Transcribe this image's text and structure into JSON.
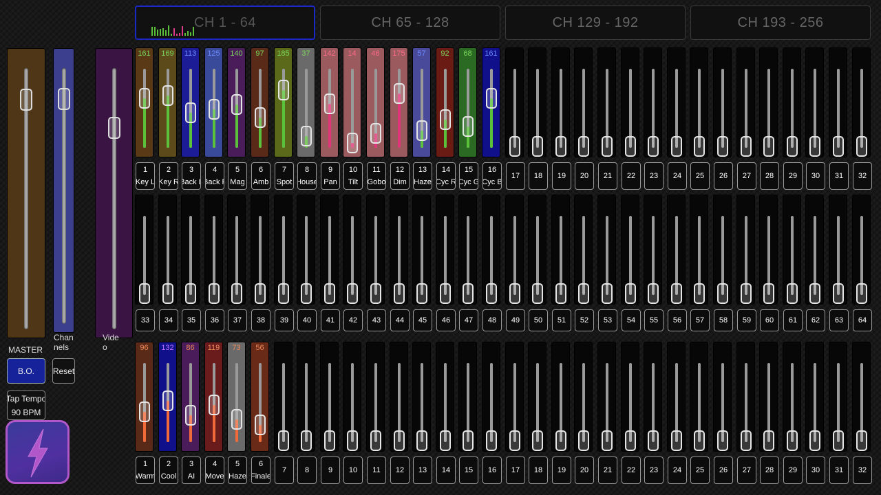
{
  "tabs": [
    {
      "label": "CH 1 - 64",
      "active": true
    },
    {
      "label": "CH 65 - 128",
      "active": false
    },
    {
      "label": "CH 129 - 192",
      "active": false
    },
    {
      "label": "CH 193 - 256",
      "active": false
    }
  ],
  "masters": {
    "master_label": "MASTER",
    "channels_label": "Chan\nnels",
    "video_label": "Vide\no",
    "bo_button": "B.O.",
    "reset_button": "Reset",
    "tap_tempo": "Tap Tempo",
    "bpm": "90 BPM",
    "master_level": 0.88,
    "channels_level": 0.88,
    "video_level": 0.77
  },
  "row1_channels": [
    {
      "num": "1",
      "name": "Key L",
      "value": "161",
      "color": "#5a3a16",
      "fill": "#5bc03a",
      "level": 0.63
    },
    {
      "num": "2",
      "name": "Key R",
      "value": "169",
      "color": "#5c4a1a",
      "fill": "#5bc03a",
      "level": 0.66
    },
    {
      "num": "3",
      "name": "Back L",
      "value": "113",
      "color": "#1c1c96",
      "fill": "#5bc03a",
      "level": 0.44
    },
    {
      "num": "4",
      "name": "Back R",
      "value": "125",
      "color": "#3a4a9a",
      "fill": "#5bc03a",
      "level": 0.49
    },
    {
      "num": "5",
      "name": "Mag",
      "value": "140",
      "color": "#4a1c5a",
      "fill": "#5bc03a",
      "level": 0.55
    },
    {
      "num": "6",
      "name": "Amb",
      "value": "97",
      "color": "#5a2a18",
      "fill": "#5bc03a",
      "level": 0.38
    },
    {
      "num": "7",
      "name": "Spot",
      "value": "185",
      "color": "#5a6a1a",
      "fill": "#5bc03a",
      "level": 0.73
    },
    {
      "num": "8",
      "name": "House",
      "value": "37",
      "color": "#6a6a6a",
      "fill": "#5bc03a",
      "level": 0.15
    },
    {
      "num": "9",
      "name": "Pan",
      "value": "142",
      "color": "#9a5a5e",
      "fill": "#e0357a",
      "level": 0.56
    },
    {
      "num": "10",
      "name": "Tilt",
      "value": "14",
      "color": "#9a5a5e",
      "fill": "#e0357a",
      "level": 0.06
    },
    {
      "num": "11",
      "name": "Gobo",
      "value": "46",
      "color": "#9a5a5e",
      "fill": "#e0357a",
      "level": 0.18
    },
    {
      "num": "12",
      "name": "Dim",
      "value": "175",
      "color": "#9a5a5e",
      "fill": "#e0357a",
      "level": 0.69
    },
    {
      "num": "13",
      "name": "Haze",
      "value": "57",
      "color": "#4a4a9a",
      "fill": "#5bc03a",
      "level": 0.22
    },
    {
      "num": "14",
      "name": "Cyc R",
      "value": "92",
      "color": "#6a1c14",
      "fill": "#5bc03a",
      "level": 0.36
    },
    {
      "num": "15",
      "name": "Cyc G",
      "value": "68",
      "color": "#2a6a22",
      "fill": "#5bc03a",
      "level": 0.27
    },
    {
      "num": "16",
      "name": "Cyc B",
      "value": "161",
      "color": "#10108a",
      "fill": "#5bc03a",
      "level": 0.63
    }
  ],
  "row1_empty_numbers": [
    "17",
    "18",
    "19",
    "20",
    "21",
    "22",
    "23",
    "24",
    "25",
    "26",
    "27",
    "28",
    "29",
    "30",
    "31",
    "32"
  ],
  "row2_numbers": [
    "33",
    "34",
    "35",
    "36",
    "37",
    "38",
    "39",
    "40",
    "41",
    "42",
    "43",
    "44",
    "45",
    "46",
    "47",
    "48",
    "49",
    "50",
    "51",
    "52",
    "53",
    "54",
    "55",
    "56",
    "57",
    "58",
    "59",
    "60",
    "61",
    "62",
    "63",
    "64"
  ],
  "row3_channels": [
    {
      "num": "1",
      "name": "Warm",
      "value": "96",
      "color": "#5a2a18",
      "fill": "#f06a3a",
      "level": 0.38
    },
    {
      "num": "2",
      "name": "Cool",
      "value": "132",
      "color": "#10108a",
      "fill": "#f06a3a",
      "level": 0.52
    },
    {
      "num": "3",
      "name": "AI",
      "value": "86",
      "color": "#4a1c5a",
      "fill": "#f06a3a",
      "level": 0.34
    },
    {
      "num": "4",
      "name": "Move",
      "value": "119",
      "color": "#6a1c1c",
      "fill": "#f06a3a",
      "level": 0.47
    },
    {
      "num": "5",
      "name": "Haze",
      "value": "73",
      "color": "#6a6a6a",
      "fill": "#f06a3a",
      "level": 0.29
    },
    {
      "num": "6",
      "name": "Finale",
      "value": "56",
      "color": "#6a2a18",
      "fill": "#f06a3a",
      "level": 0.22
    }
  ],
  "row3_empty_numbers": [
    "7",
    "8",
    "9",
    "10",
    "11",
    "12",
    "13",
    "14",
    "15",
    "16",
    "17",
    "18",
    "19",
    "20",
    "21",
    "22",
    "23",
    "24",
    "25",
    "26",
    "27",
    "28",
    "29",
    "30",
    "31",
    "32"
  ],
  "colors": {
    "value_text_green": "#7ad85a",
    "value_text_pink": "#ff6a8a",
    "value_text_orange": "#f08a5a",
    "value_text_blue": "#6a8aff"
  }
}
